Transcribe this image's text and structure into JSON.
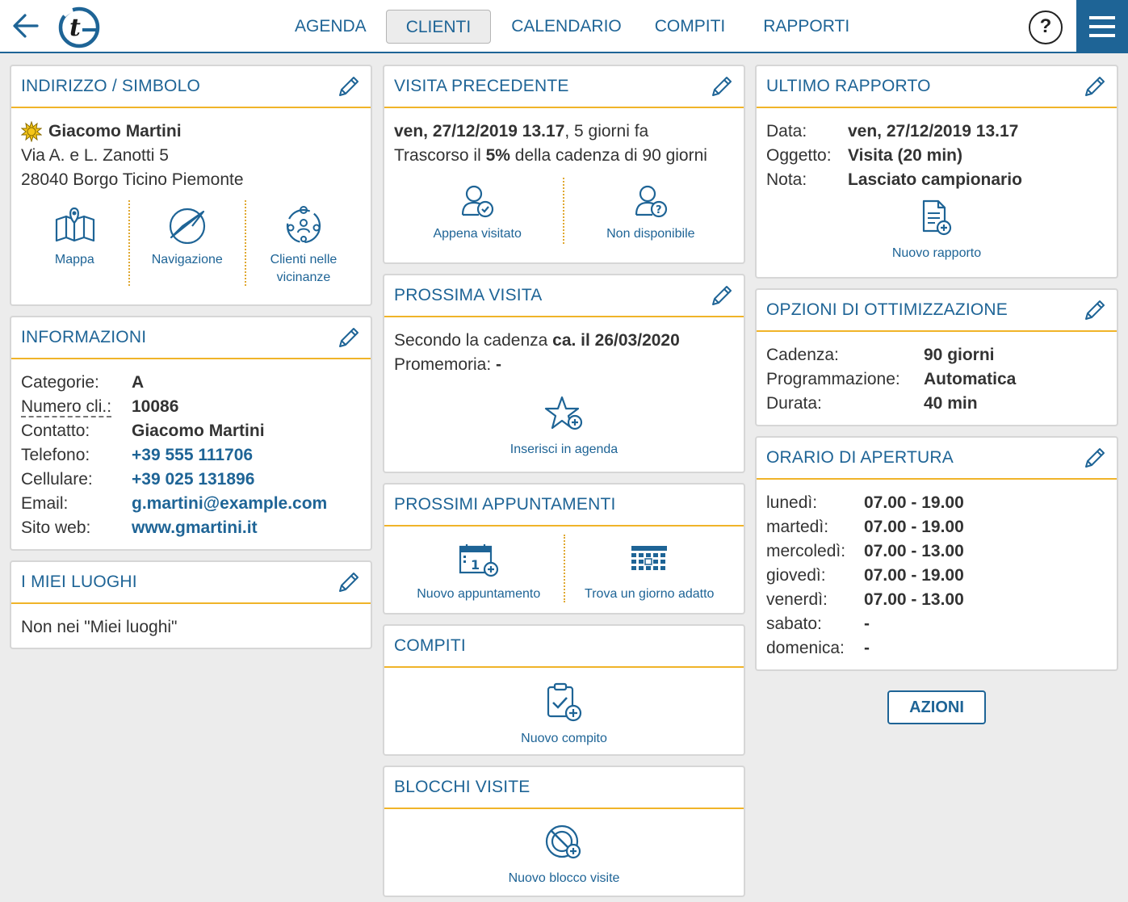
{
  "header": {
    "tabs": [
      {
        "label": "AGENDA"
      },
      {
        "label": "CLIENTI"
      },
      {
        "label": "CALENDARIO"
      },
      {
        "label": "COMPITI"
      },
      {
        "label": "RAPPORTI"
      }
    ],
    "help": "?"
  },
  "address": {
    "title": "INDIRIZZO / SIMBOLO",
    "name": "Giacomo Martini",
    "street": "Via A. e L. Zanotti 5",
    "city": "28040 Borgo Ticino Piemonte",
    "actions": [
      "Mappa",
      "Navigazione",
      "Clienti nelle",
      "vicinanze"
    ]
  },
  "info": {
    "title": "INFORMAZIONI",
    "labels": [
      "Categorie:",
      "Numero cli.:",
      "Contatto:",
      "Telefono:",
      "Cellulare:",
      "Email:",
      "Sito web:"
    ],
    "values": [
      "A",
      "10086",
      "Giacomo Martini",
      "+39 555 111706",
      "+39 025 131896",
      "g.martini@example.com",
      "www.gmartini.it"
    ]
  },
  "places": {
    "title": "I MIEI LUOGHI",
    "text": "Non nei \"Miei luoghi\""
  },
  "prev_visit": {
    "title": "VISITA PRECEDENTE",
    "date": "ven, 27/12/2019 13.17",
    "ago": ", 5 giorni fa",
    "elapsed_pre": "Trascorso il ",
    "elapsed_pct": "5%",
    "elapsed_post": " della cadenza di 90 giorni",
    "actions": [
      "Appena visitato",
      "Non disponibile"
    ]
  },
  "next_visit": {
    "title": "PROSSIMA VISITA",
    "cadence_pre": "Secondo la cadenza ",
    "cadence_date": "ca. il 26/03/2020",
    "reminder_label": "Promemoria: ",
    "reminder_value": "-",
    "action": "Inserisci in agenda"
  },
  "appointments": {
    "title": "PROSSIMI APPUNTAMENTI",
    "actions": [
      "Nuovo appuntamento",
      "Trova un giorno adatto"
    ]
  },
  "tasks": {
    "title": "COMPITI",
    "action": "Nuovo compito"
  },
  "blocks": {
    "title": "BLOCCHI VISITE",
    "action": "Nuovo blocco visite"
  },
  "last_report": {
    "title": "ULTIMO RAPPORTO",
    "labels": [
      "Data:",
      "Oggetto:",
      "Nota:"
    ],
    "values": [
      "ven, 27/12/2019 13.17",
      "Visita (20 min)",
      "Lasciato campionario"
    ],
    "action": "Nuovo rapporto"
  },
  "optimization": {
    "title": "OPZIONI DI OTTIMIZZAZIONE",
    "labels": [
      "Cadenza:",
      "Programmazione:",
      "Durata:"
    ],
    "values": [
      "90 giorni",
      "Automatica",
      "40 min"
    ]
  },
  "hours": {
    "title": "ORARIO DI APERTURA",
    "days": [
      "lunedì:",
      "martedì:",
      "mercoledì:",
      "giovedì:",
      "venerdì:",
      "sabato:",
      "domenica:"
    ],
    "times": [
      "07.00 - 19.00",
      "07.00 - 19.00",
      "07.00 - 13.00",
      "07.00 - 19.00",
      "07.00 - 13.00",
      "-",
      "-"
    ]
  },
  "azioni": "AZIONI",
  "colors": {
    "primary": "#1e6496",
    "accent": "#f0b429",
    "background": "#ececec"
  }
}
